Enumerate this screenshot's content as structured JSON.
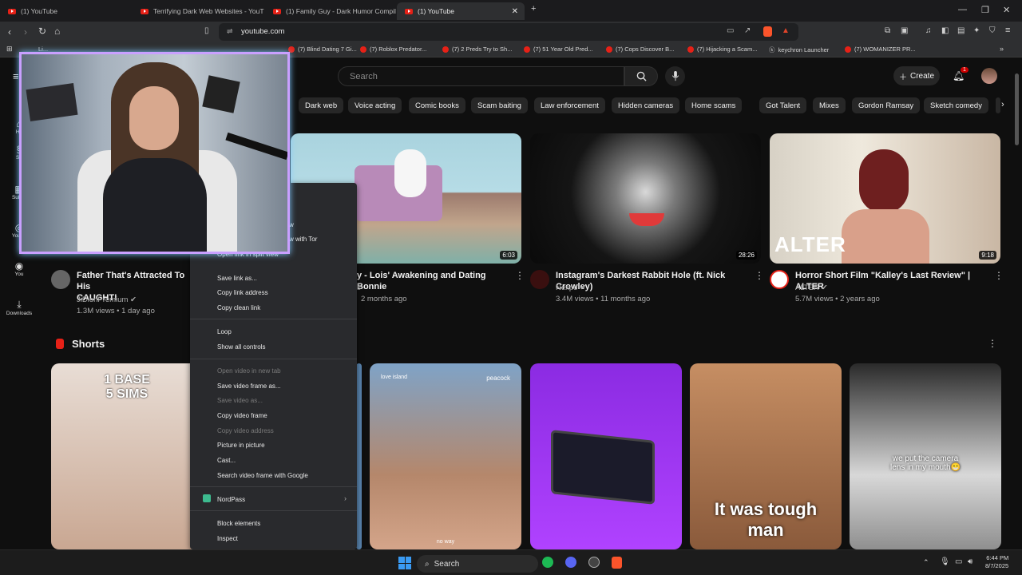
{
  "browser": {
    "tabs": [
      {
        "label": "(1) YouTube",
        "active": false
      },
      {
        "label": "Terrifying Dark Web Websites - YouT",
        "active": false
      },
      {
        "label": "(1) Family Guy - Dark Humor Compil",
        "active": false
      },
      {
        "label": "(1) YouTube",
        "active": true
      }
    ],
    "url": "youtube.com",
    "bookmarks": [
      "Li...",
      "(7) Blind Dating 7 Gi...",
      "(7) Roblox Predator...",
      "(7) 2 Preds Try to Sh...",
      "(7) 51 Year Old Pred...",
      "(7) Cops Discover B...",
      "(7) Hijacking a Scam...",
      "keychron Launcher",
      "(7) WOMANIZER PR..."
    ]
  },
  "youtube": {
    "search_placeholder": "Search",
    "create_label": "Create",
    "notification_count": "1",
    "chips": [
      "Dark web",
      "Voice acting",
      "Comic books",
      "Scam baiting",
      "Law enforcement",
      "Hidden cameras",
      "Home scams",
      "Got Talent",
      "Mixes",
      "Gordon Ramsay",
      "Sketch comedy"
    ],
    "sidebar": [
      {
        "label": "Ho"
      },
      {
        "label": "Sh"
      },
      {
        "label": "Subsc"
      },
      {
        "label": "YouTu"
      },
      {
        "label": "You"
      },
      {
        "label": "Downloads"
      }
    ],
    "videos": [
      {
        "title": "Father That's Attracted To His",
        "title2": "CAUGHT!",
        "channel": "JiDionPremium",
        "stats": "1.3M views • 1 day ago",
        "duration": ""
      },
      {
        "title": "y - Lois' Awakening and Dating Bonnie",
        "title2": "",
        "channel": "s",
        "stats": "2 months ago",
        "duration": "6:03"
      },
      {
        "title": "Instagram's Darkest Rabbit Hole (ft. Nick Crowley)",
        "title2": "",
        "channel": "Nexpo",
        "stats": "3.4M views • 11 months ago",
        "duration": "28:26"
      },
      {
        "title": "Horror Short Film \"Kalley's Last Review\" | ALTER",
        "title2": "",
        "channel": "ALTER",
        "stats": "5.7M views • 2 years ago",
        "duration": "9:18",
        "thumb_text": "ALTER"
      }
    ],
    "shorts_heading": "Shorts",
    "shorts": [
      {
        "overlay": "1 BASE\n5 SIMS"
      },
      {
        "overlay": "no way",
        "brand_left": "love island",
        "brand_right": "peacock"
      },
      {
        "overlay": ""
      },
      {
        "overlay": "It was tough\nman"
      },
      {
        "overlay": "we put the camera\nlens in my mouth😁"
      }
    ]
  },
  "context_menu": {
    "partial_items": [
      "w",
      "w with Tor",
      "Open link in split view"
    ],
    "items": [
      {
        "label": "Save link as...",
        "disabled": false
      },
      {
        "label": "Copy link address",
        "disabled": false
      },
      {
        "label": "Copy clean link",
        "disabled": false
      },
      {
        "label": "Loop",
        "disabled": false
      },
      {
        "label": "Show all controls",
        "disabled": false
      },
      {
        "label": "Open video in new tab",
        "disabled": true
      },
      {
        "label": "Save video frame as...",
        "disabled": false
      },
      {
        "label": "Save video as...",
        "disabled": true
      },
      {
        "label": "Copy video frame",
        "disabled": false
      },
      {
        "label": "Copy video address",
        "disabled": true
      },
      {
        "label": "Picture in picture",
        "disabled": false
      },
      {
        "label": "Cast...",
        "disabled": false
      },
      {
        "label": "Search video frame with Google",
        "disabled": false
      },
      {
        "label": "NordPass",
        "disabled": false
      },
      {
        "label": "Block elements",
        "disabled": false
      },
      {
        "label": "Inspect",
        "disabled": false
      }
    ]
  },
  "taskbar": {
    "search_label": "Search",
    "time": "6:44 PM",
    "date": "8/7/2025"
  },
  "colors": {
    "youtube_red": "#e62117",
    "background": "#0f0f0f",
    "menu_bg": "#292a2d",
    "cam_border": "#c9a0ff"
  }
}
